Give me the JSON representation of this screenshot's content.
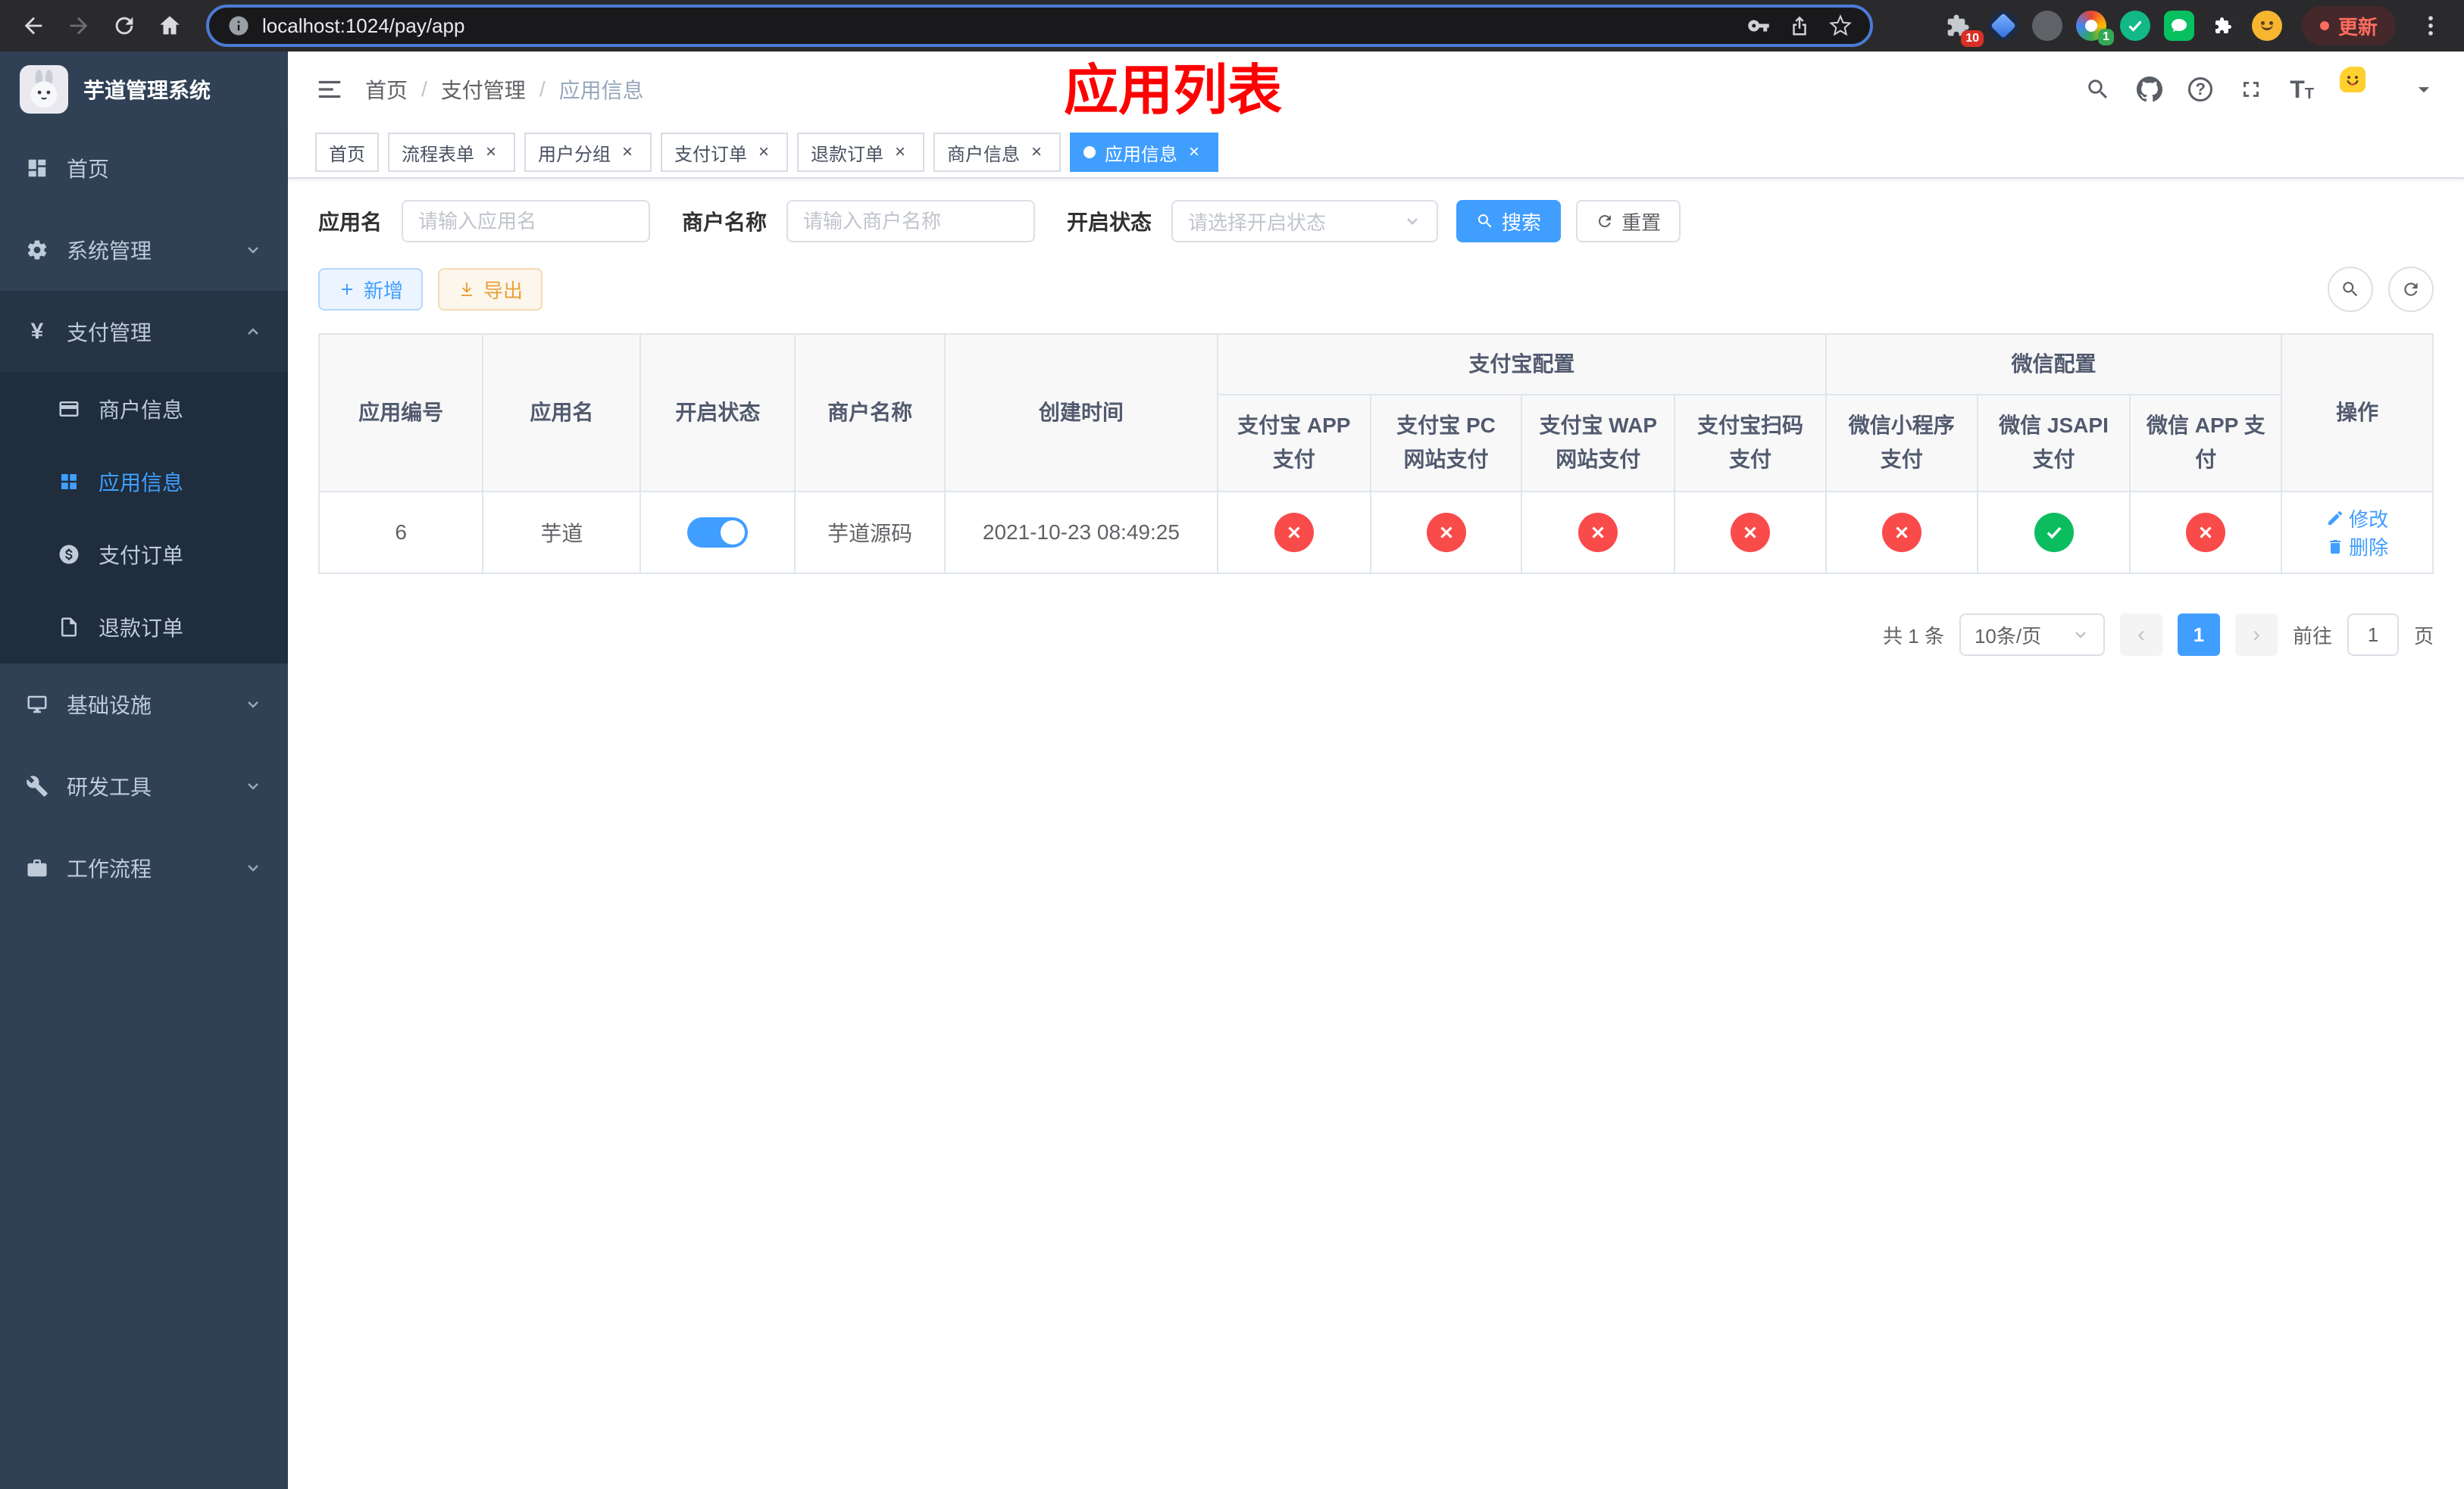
{
  "browser": {
    "url": "localhost:1024/pay/app",
    "update_label": "更新",
    "extensions_badge": "10",
    "extension_badge_1": "1"
  },
  "app_title": "芋道管理系统",
  "sidebar": {
    "items": [
      {
        "label": "首页"
      },
      {
        "label": "系统管理"
      },
      {
        "label": "支付管理"
      },
      {
        "label": "商户信息"
      },
      {
        "label": "应用信息"
      },
      {
        "label": "支付订单"
      },
      {
        "label": "退款订单"
      },
      {
        "label": "基础设施"
      },
      {
        "label": "研发工具"
      },
      {
        "label": "工作流程"
      }
    ]
  },
  "navbar": {
    "breadcrumb": {
      "home": "首页",
      "section": "支付管理",
      "current": "应用信息",
      "separator": "/"
    },
    "overlay_title": "应用列表"
  },
  "tabs": [
    {
      "label": "首页"
    },
    {
      "label": "流程表单"
    },
    {
      "label": "用户分组"
    },
    {
      "label": "支付订单"
    },
    {
      "label": "退款订单"
    },
    {
      "label": "商户信息"
    },
    {
      "label": "应用信息"
    }
  ],
  "filter": {
    "app_name_label": "应用名",
    "app_name_placeholder": "请输入应用名",
    "merchant_label": "商户名称",
    "merchant_placeholder": "请输入商户名称",
    "status_label": "开启状态",
    "status_placeholder": "请选择开启状态",
    "search_label": "搜索",
    "reset_label": "重置"
  },
  "toolbar": {
    "add_label": "新增",
    "export_label": "导出"
  },
  "table": {
    "headers": {
      "app_id": "应用编号",
      "app_name": "应用名",
      "status": "开启状态",
      "merchant": "商户名称",
      "created": "创建时间",
      "alipay_group": "支付宝配置",
      "wechat_group": "微信配置",
      "alipay_app": "支付宝 APP 支付",
      "alipay_pc": "支付宝 PC 网站支付",
      "alipay_wap": "支付宝 WAP 网站支付",
      "alipay_qr": "支付宝扫码支付",
      "wx_lite": "微信小程序支付",
      "wx_jsapi": "微信 JSAPI 支付",
      "wx_app": "微信 APP 支付",
      "actions": "操作"
    },
    "rows": [
      {
        "app_id": "6",
        "app_name": "芋道",
        "enabled": "on",
        "merchant": "芋道源码",
        "created": "2021-10-23 08:49:25",
        "configs": {
          "alipay_app": "err",
          "alipay_pc": "err",
          "alipay_wap": "err",
          "alipay_qr": "err",
          "wx_lite": "err",
          "wx_jsapi": "ok",
          "wx_app": "err"
        },
        "edit_label": "修改",
        "delete_label": "删除"
      }
    ]
  },
  "pagination": {
    "total": "共 1 条",
    "page_size": "10条/页",
    "current_page": "1",
    "goto_label": "前往",
    "goto_value": "1",
    "page_unit": "页"
  },
  "colors": {
    "primary": "#409eff",
    "success": "#0bbd5f",
    "danger": "#fa4b4b",
    "warning": "#e6a23c",
    "sidebar_bg": "#304156",
    "submenu_bg": "#1f2d3d",
    "overlay_title": "#ff0000"
  }
}
